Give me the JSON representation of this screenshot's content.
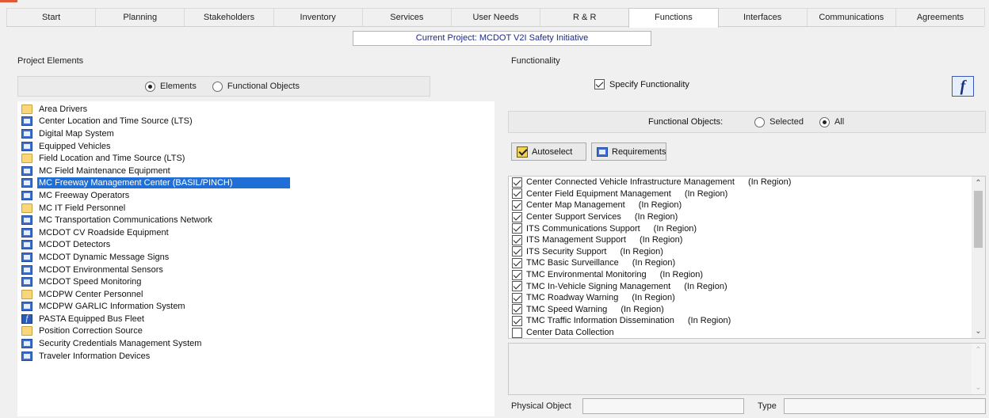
{
  "tabs": [
    "Start",
    "Planning",
    "Stakeholders",
    "Inventory",
    "Services",
    "User Needs",
    "R & R",
    "Functions",
    "Interfaces",
    "Communications",
    "Agreements"
  ],
  "active_tab": "Functions",
  "current_project": "Current Project: MCDOT V2I Safety Initiative",
  "left": {
    "title": "Project Elements",
    "radio_elements": "Elements",
    "radio_functional_objects": "Functional Objects",
    "selected_radio": "Elements",
    "items": [
      {
        "label": "Area Drivers",
        "icon": "folder-icon"
      },
      {
        "label": "Center Location and Time Source (LTS)",
        "icon": "system-object-icon"
      },
      {
        "label": "Digital Map System",
        "icon": "system-object-icon"
      },
      {
        "label": "Equipped Vehicles",
        "icon": "system-object-icon"
      },
      {
        "label": "Field Location and Time Source (LTS)",
        "icon": "folder-icon"
      },
      {
        "label": "MC Field Maintenance Equipment",
        "icon": "system-object-icon"
      },
      {
        "label": "MC Freeway Management Center (BASIL/PINCH)",
        "icon": "system-object-icon",
        "selected": true
      },
      {
        "label": "MC Freeway Operators",
        "icon": "system-object-icon"
      },
      {
        "label": "MC IT Field Personnel",
        "icon": "folder-icon"
      },
      {
        "label": "MC Transportation Communications Network",
        "icon": "system-object-icon"
      },
      {
        "label": "MCDOT CV Roadside Equipment",
        "icon": "system-object-icon"
      },
      {
        "label": "MCDOT Detectors",
        "icon": "system-object-icon"
      },
      {
        "label": "MCDOT Dynamic Message Signs",
        "icon": "system-object-icon"
      },
      {
        "label": "MCDOT Environmental Sensors",
        "icon": "system-object-icon"
      },
      {
        "label": "MCDOT Speed Monitoring",
        "icon": "system-object-icon"
      },
      {
        "label": "MCDPW Center Personnel",
        "icon": "folder-icon"
      },
      {
        "label": "MCDPW GARLIC Information System",
        "icon": "system-object-icon"
      },
      {
        "label": "PASTA Equipped Bus Fleet",
        "icon": "function-object-icon"
      },
      {
        "label": "Position Correction Source",
        "icon": "folder-icon"
      },
      {
        "label": "Security Credentials Management System",
        "icon": "system-object-icon"
      },
      {
        "label": "Traveler Information Devices",
        "icon": "system-object-icon"
      }
    ]
  },
  "right": {
    "title": "Functionality",
    "specify_label": "Specify Functionality",
    "specify_checked": true,
    "f_button": "f",
    "fo_label": "Functional Objects:",
    "radio_selected": "Selected",
    "radio_all": "All",
    "selected_radio": "All",
    "autoselect_label": "Autoselect",
    "requirements_label": "Requirements",
    "functions": [
      {
        "name": "Center Connected Vehicle Infrastructure Management",
        "region": "(In Region)",
        "checked": true
      },
      {
        "name": "Center Field Equipment Management",
        "region": "(In Region)",
        "checked": true
      },
      {
        "name": "Center Map Management",
        "region": "(In Region)",
        "checked": true
      },
      {
        "name": "Center Support Services",
        "region": "(In Region)",
        "checked": true
      },
      {
        "name": "ITS Communications Support",
        "region": "(In Region)",
        "checked": true
      },
      {
        "name": "ITS Management Support",
        "region": "(In Region)",
        "checked": true
      },
      {
        "name": "ITS Security Support",
        "region": "(In Region)",
        "checked": true
      },
      {
        "name": "TMC Basic Surveillance",
        "region": "(In Region)",
        "checked": true
      },
      {
        "name": "TMC Environmental Monitoring",
        "region": "(In Region)",
        "checked": true
      },
      {
        "name": "TMC In-Vehicle Signing Management",
        "region": "(In Region)",
        "checked": true
      },
      {
        "name": "TMC Roadway Warning",
        "region": "(In Region)",
        "checked": true
      },
      {
        "name": "TMC Speed Warning",
        "region": "(In Region)",
        "checked": true
      },
      {
        "name": "TMC Traffic Information Dissemination",
        "region": "(In Region)",
        "checked": true
      },
      {
        "name": "Center Data Collection",
        "region": "",
        "checked": false
      }
    ],
    "physical_object_label": "Physical Object",
    "type_label": "Type"
  },
  "colors": {
    "selection": "#1f6fd6",
    "project_text": "#1a2a8c"
  }
}
